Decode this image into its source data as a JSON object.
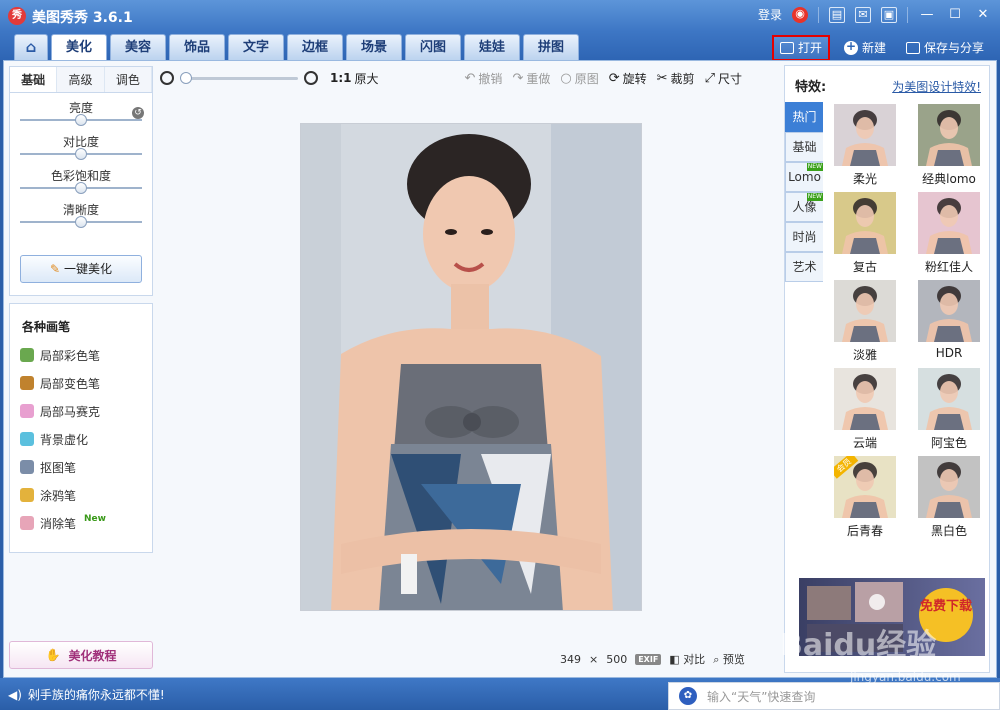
{
  "app": {
    "logo_char": "秀",
    "title": "美图秀秀 3.6.1",
    "login": "登录"
  },
  "nav": {
    "tabs": [
      {
        "label": "⌂"
      },
      {
        "label": "美化"
      },
      {
        "label": "美容"
      },
      {
        "label": "饰品"
      },
      {
        "label": "文字"
      },
      {
        "label": "边框"
      },
      {
        "label": "场景"
      },
      {
        "label": "闪图"
      },
      {
        "label": "娃娃"
      },
      {
        "label": "拼图"
      }
    ],
    "open_label": "打开",
    "new_label": "新建",
    "save_label": "保存与分享"
  },
  "left": {
    "tabs": [
      {
        "label": "基础"
      },
      {
        "label": "高级"
      },
      {
        "label": "调色"
      }
    ],
    "sliders": [
      {
        "label": "亮度",
        "value": 0.5
      },
      {
        "label": "对比度",
        "value": 0.5
      },
      {
        "label": "色彩饱和度",
        "value": 0.5
      },
      {
        "label": "清晰度",
        "value": 0.5
      }
    ],
    "onekey_label": "一键美化",
    "brush_title": "各种画笔",
    "brushes": [
      {
        "label": "局部彩色笔",
        "color": "#6aa84f"
      },
      {
        "label": "局部变色笔",
        "color": "#c0822e"
      },
      {
        "label": "局部马赛克",
        "color": "#e8a0d0"
      },
      {
        "label": "背景虚化",
        "color": "#5bc0de"
      },
      {
        "label": "抠图笔",
        "color": "#7b8da8"
      },
      {
        "label": "涂鸦笔",
        "color": "#e3b23c"
      },
      {
        "label": "消除笔",
        "color": "#e7a5b8",
        "badge": "New"
      }
    ],
    "tutorial_label": "美化教程"
  },
  "toolbar": {
    "ratio_label": "1:1",
    "original_size_label": "原大",
    "undo_label": "撤销",
    "redo_label": "重做",
    "orig_label": "原图",
    "rotate_label": "旋转",
    "crop_label": "裁剪",
    "size_label": "尺寸"
  },
  "status": {
    "width": "349",
    "x": "×",
    "height": "500",
    "exif": "EXIF",
    "compare_label": "对比",
    "preview_label": "预览"
  },
  "right": {
    "title": "特效:",
    "link": "为美图设计特效!",
    "categories": [
      {
        "label": "热门",
        "active": true
      },
      {
        "label": "基础"
      },
      {
        "label": "Lomo",
        "new": true
      },
      {
        "label": "人像",
        "new": true
      },
      {
        "label": "时尚"
      },
      {
        "label": "艺术"
      }
    ],
    "effects": [
      {
        "label": "柔光",
        "tint": "#d9d2d6"
      },
      {
        "label": "经典lomo",
        "tint": "#9aa38a"
      },
      {
        "label": "复古",
        "tint": "#d8c98a"
      },
      {
        "label": "粉红佳人",
        "tint": "#e6c5d0"
      },
      {
        "label": "淡雅",
        "tint": "#dcdad6"
      },
      {
        "label": "HDR",
        "tint": "#b3b6bd"
      },
      {
        "label": "云端",
        "tint": "#e8e4de"
      },
      {
        "label": "阿宝色",
        "tint": "#d6dfe0"
      },
      {
        "label": "后青春",
        "tint": "#e8e2c4",
        "badge": "会员"
      },
      {
        "label": "黑白色",
        "tint": "#c2c2c2"
      }
    ],
    "ad_text": "免费下载"
  },
  "bottom": {
    "message": "剁手族的痛你永远都不懂!",
    "search_placeholder": "输入“天气”快速查询"
  },
  "watermark": {
    "text": "Baidu经验",
    "url": "jingyan.baidu.com"
  }
}
